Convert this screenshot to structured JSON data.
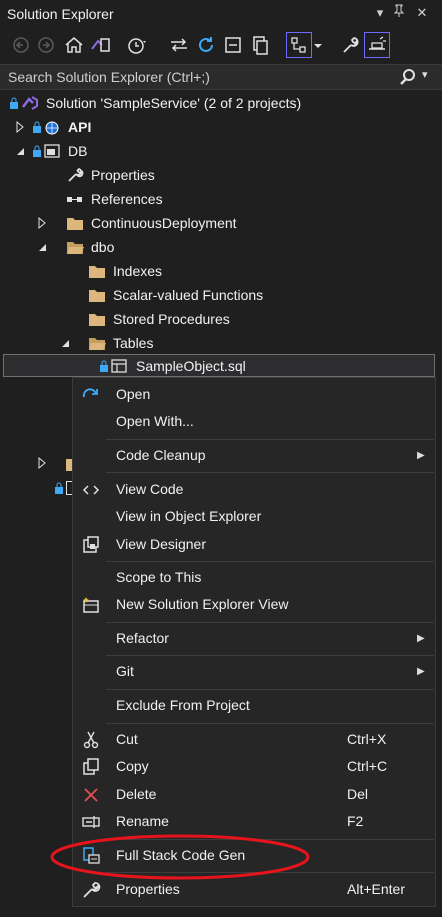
{
  "window": {
    "title": "Solution Explorer"
  },
  "search": {
    "placeholder": "Search Solution Explorer (Ctrl+;)"
  },
  "tree": {
    "solution": "Solution 'SampleService' (2 of 2 projects)",
    "api": "API",
    "db": "DB",
    "properties": "Properties",
    "references": "References",
    "continuous": "ContinuousDeployment",
    "dbo": "dbo",
    "indexes": "Indexes",
    "scalar": "Scalar-valued Functions",
    "stored": "Stored Procedures",
    "tables": "Tables",
    "sample": "SampleObject.sql"
  },
  "menu": {
    "open": "Open",
    "open_with": "Open With...",
    "code_cleanup": "Code Cleanup",
    "view_code": "View Code",
    "view_object_explorer": "View in Object Explorer",
    "view_designer": "View Designer",
    "scope": "Scope to This",
    "new_view": "New Solution Explorer View",
    "refactor": "Refactor",
    "git": "Git",
    "exclude": "Exclude From Project",
    "cut": "Cut",
    "cut_sc": "Ctrl+X",
    "copy": "Copy",
    "copy_sc": "Ctrl+C",
    "delete": "Delete",
    "delete_sc": "Del",
    "rename": "Rename",
    "rename_sc": "F2",
    "fullstack": "Full Stack Code Gen",
    "properties": "Properties",
    "properties_sc": "Alt+Enter"
  },
  "colors": {
    "accent": "#6c6cff",
    "highlight_ring": "#e8141c",
    "folder": "#dcb67a",
    "vs_purple": "#8c6be0"
  }
}
